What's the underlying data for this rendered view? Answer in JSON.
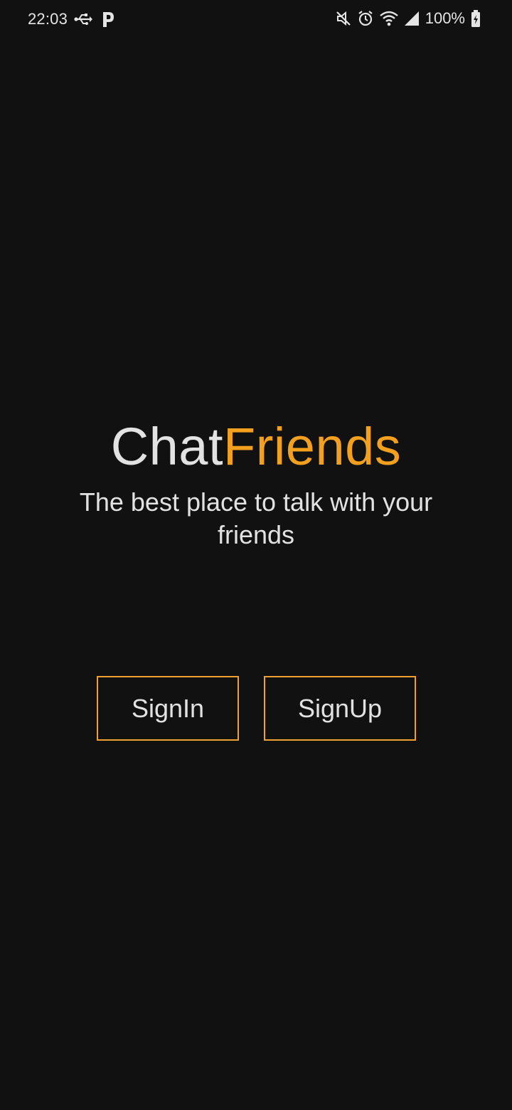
{
  "status_bar": {
    "time": "22:03",
    "battery_percent": "100%",
    "icons": [
      "usb-icon",
      "parking-p-icon",
      "mute-icon",
      "alarm-icon",
      "wifi-icon",
      "cell-signal-icon",
      "battery-icon"
    ]
  },
  "brand": {
    "title_part1": "Chat",
    "title_part2": "Friends",
    "tagline": "The best place to talk with your friends"
  },
  "actions": {
    "signin_label": "SignIn",
    "signup_label": "SignUp"
  },
  "colors": {
    "background": "#121112",
    "accent": "#f4a01f",
    "text": "#e2e2e2"
  }
}
